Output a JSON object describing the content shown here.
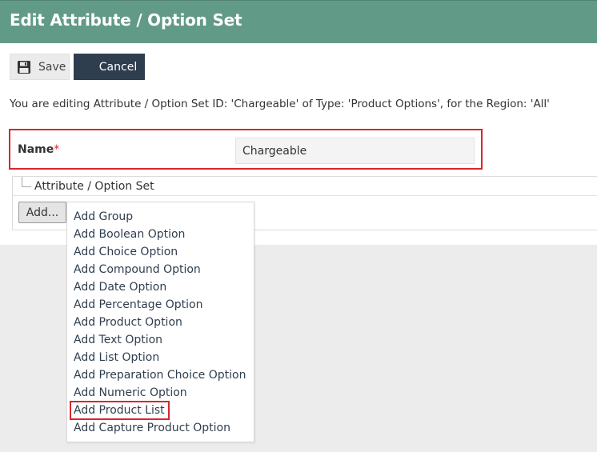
{
  "header": {
    "title": "Edit Attribute / Option Set"
  },
  "toolbar": {
    "save_label": "Save",
    "cancel_label": "Cancel"
  },
  "info_text": "You are editing Attribute / Option Set ID: 'Chargeable' of Type: 'Product Options', for the Region: 'All'",
  "form": {
    "name_label": "Name",
    "required_marker": "*",
    "name_value": "Chargeable"
  },
  "tree": {
    "root_label": "Attribute / Option Set",
    "add_button_label": "Add..."
  },
  "add_menu": {
    "items": [
      "Add Group",
      "Add Boolean Option",
      "Add Choice Option",
      "Add Compound Option",
      "Add Date Option",
      "Add Percentage Option",
      "Add Product Option",
      "Add Text Option",
      "Add List Option",
      "Add Preparation Choice Option",
      "Add Numeric Option",
      "Add Product List",
      "Add Capture Product Option"
    ],
    "highlighted_item": "Add Product List"
  },
  "colors": {
    "header_bg": "#629a88",
    "cancel_bg": "#2f3e4e",
    "highlight": "#d7262e"
  },
  "icons": {
    "save": "floppy-disk-icon"
  }
}
